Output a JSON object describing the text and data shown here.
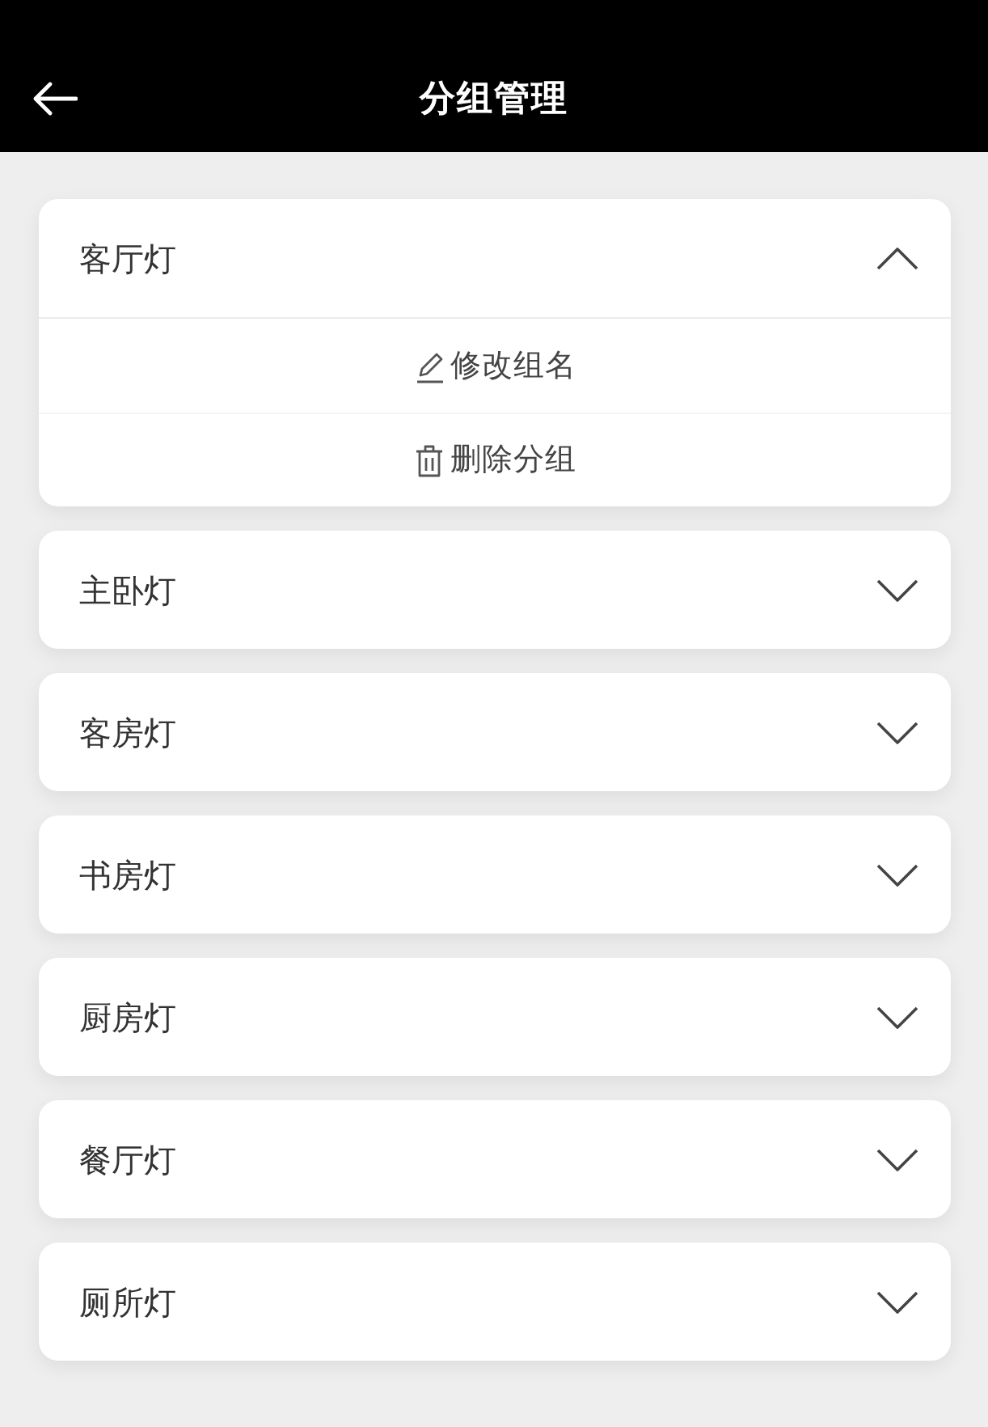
{
  "header": {
    "title": "分组管理"
  },
  "groups": [
    {
      "name": "客厅灯",
      "expanded": true,
      "actions": [
        {
          "kind": "rename",
          "label": "修改组名"
        },
        {
          "kind": "delete",
          "label": "删除分组"
        }
      ]
    },
    {
      "name": "主卧灯",
      "expanded": false
    },
    {
      "name": "客房灯",
      "expanded": false
    },
    {
      "name": "书房灯",
      "expanded": false
    },
    {
      "name": "厨房灯",
      "expanded": false
    },
    {
      "name": "餐厅灯",
      "expanded": false
    },
    {
      "name": "厕所灯",
      "expanded": false
    }
  ]
}
